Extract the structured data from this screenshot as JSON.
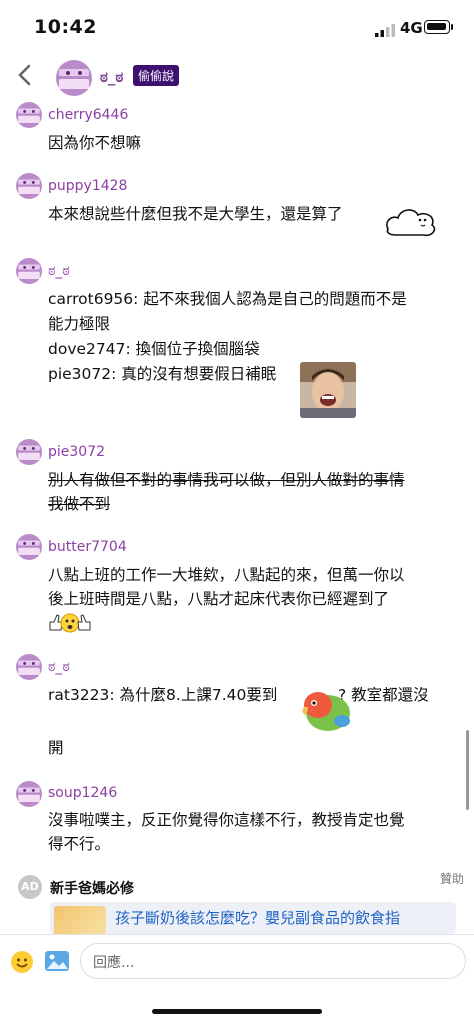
{
  "status": {
    "time": "10:42",
    "network": "4G"
  },
  "header": {
    "name": "ಠ_ಠ",
    "badge": "偷偷說"
  },
  "posts": [
    {
      "user": "cherry6446",
      "lines": [
        "因為你不想嘛"
      ]
    },
    {
      "user": "puppy1428",
      "lines": [
        "本來想說些什麼但我不是大學生，還是算了"
      ]
    },
    {
      "user": "ಠ_ಠ",
      "lines": [
        "carrot6956: 起不來我個人認為是自己的問題而不是",
        "能力極限",
        "dove2747: 換個位子換個腦袋",
        "pie3072: 真的沒有想要假日補眠"
      ]
    },
    {
      "user": "pie3072",
      "lines": [
        "別人有做但不對的事情我可以做，但別人做對的事情",
        "我做不到"
      ]
    },
    {
      "user": "butter7704",
      "lines": [
        "八點上班的工作一大堆欸，八點起的來，但萬一你以",
        "後上班時間是八點，八點才起床代表你已經遲到了"
      ]
    },
    {
      "user": "ಠ_ಠ",
      "lines": [
        "rat3223: 為什麼8.上課7.40要到",
        "? 教室都還沒",
        "開"
      ]
    },
    {
      "user": "soup1246",
      "lines": [
        "沒事啦噗主，反正你覺得你這樣不行，教授肯定也覺",
        "得不行。"
      ]
    }
  ],
  "ad": {
    "avatar_text": "AD",
    "source": "新手爸媽必修",
    "tag": "贊助",
    "title": "孩子斷奶後該怎麼吃？嬰兒副食品的飲食指"
  },
  "composer": {
    "placeholder": "回應..."
  },
  "icons": {
    "back": "chevron-left-icon",
    "emoji": "smiley-icon",
    "image": "image-icon",
    "avatar": "purple-mask-avatar"
  },
  "colors": {
    "username": "#8b3fa3",
    "badge": "#3d0f6e",
    "link": "#1e63c4"
  }
}
